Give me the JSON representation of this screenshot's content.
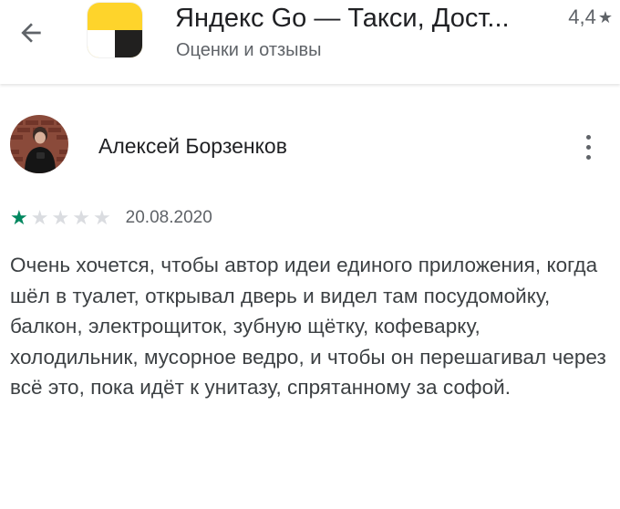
{
  "header": {
    "app_title": "Яндекс Go — Такси, Дост...",
    "subtitle": "Оценки и отзывы",
    "rating": "4,4",
    "rating_star": "★",
    "icon": "yandex-go-app-icon"
  },
  "review": {
    "author": "Алексей Борзенков",
    "rating": 1,
    "max_rating": 5,
    "date": "20.08.2020",
    "text": "Очень хочется, чтобы автор идеи единого приложения, когда шёл в туалет, открывал дверь и видел там посудомойку, балкон, электрощиток, зубную щётку, кофеварку, холодильник, мусорное ведро, и чтобы он перешагивал через всё это, пока идёт к унитазу, спрятанному за софой."
  },
  "colors": {
    "star_filled": "#01875f",
    "star_empty": "#dadce0",
    "text_primary": "#202124",
    "text_secondary": "#5f6368",
    "brand_yellow": "#fc3f1d"
  }
}
